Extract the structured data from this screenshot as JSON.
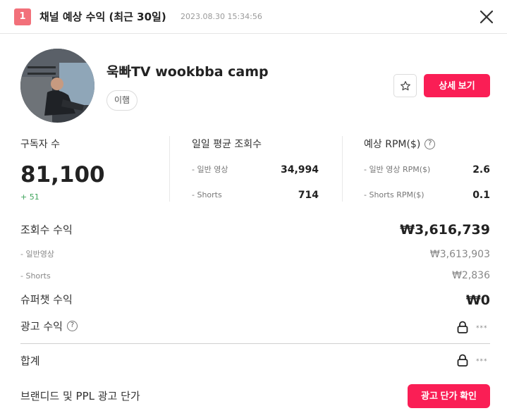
{
  "header": {
    "rank": "1",
    "title": "채널 예상 수익 (최근 30일)",
    "timestamp": "2023.08.30 15:34:56",
    "close_icon": "close-icon"
  },
  "channel": {
    "name": "욱빠TV wookbba camp",
    "tag": "이햄",
    "star_icon": "star-icon",
    "detail_button": "상세 보기"
  },
  "stats": {
    "subscribers": {
      "label": "구독자 수",
      "value": "81,100",
      "delta": "+ 51"
    },
    "avg_views": {
      "label": "일일 평균 조회수",
      "rows": [
        {
          "label": "- 일반 영상",
          "value": "34,994"
        },
        {
          "label": "- Shorts",
          "value": "714"
        }
      ]
    },
    "rpm": {
      "label": "예상 RPM($)",
      "help_icon": "?",
      "rows": [
        {
          "label": "- 일반 영상 RPM($)",
          "value": "2.6"
        },
        {
          "label": "- Shorts RPM($)",
          "value": "0.1"
        }
      ]
    }
  },
  "revenue": {
    "views_revenue": {
      "label": "조회수 수익",
      "value": "₩3,616,739"
    },
    "normal_video": {
      "label": "- 일반영상",
      "value": "₩3,613,903"
    },
    "shorts": {
      "label": "- Shorts",
      "value": "₩2,836"
    },
    "superchat": {
      "label": "슈퍼챗 수익",
      "value": "₩0"
    },
    "ad_revenue": {
      "label": "광고 수익",
      "help_icon": "?",
      "masked": "***"
    },
    "total": {
      "label": "합계",
      "masked": "***"
    }
  },
  "branded": {
    "label": "브랜디드 및 PPL 광고 단가",
    "button": "광고 단가 확인"
  },
  "colors": {
    "accent": "#fa1e55",
    "badge": "#f2707a",
    "delta_green": "#3fa45b"
  }
}
